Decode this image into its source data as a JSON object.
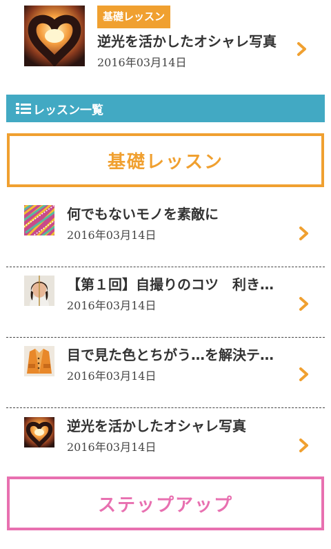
{
  "featured": {
    "badge": "基礎レッスン",
    "title": "逆光を活かしたオシャレ写真",
    "date": "2016年03月14日"
  },
  "section": {
    "icon": "list-icon",
    "label": "レッスン一覧"
  },
  "categories": {
    "basic": "基礎レッスン",
    "stepup": "ステップアップ"
  },
  "items": [
    {
      "title": "何でもないモノを素敵に",
      "date": "2016年03月14日"
    },
    {
      "title": "【第１回】自撮りのコツ　利き…",
      "date": "2016年03月14日"
    },
    {
      "title": "目で見た色とちがう…を解決テ…",
      "date": "2016年03月14日"
    },
    {
      "title": "逆光を活かしたオシャレ写真",
      "date": "2016年03月14日"
    }
  ],
  "colors": {
    "accent_orange": "#f0a030",
    "section_blue": "#42a9c3",
    "step_pink": "#e870b0"
  }
}
